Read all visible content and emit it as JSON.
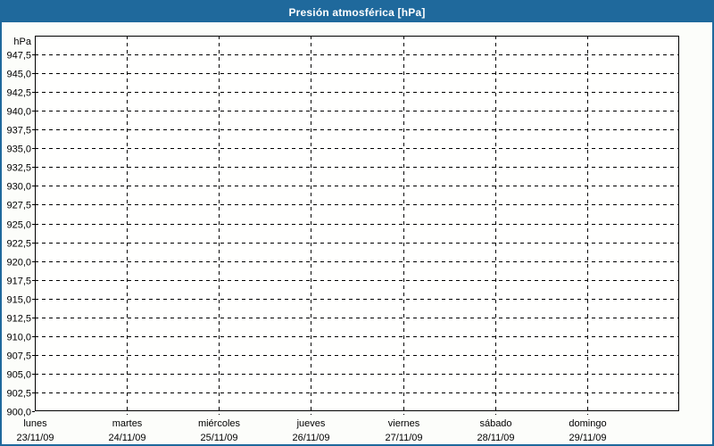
{
  "window": {
    "title": "Presión atmosférica [hPa]"
  },
  "chart_data": {
    "type": "line",
    "title": "Presión atmosférica [hPa]",
    "grid": "dashed",
    "legend": "none",
    "series": [],
    "y_axis": {
      "unit_label": "hPa",
      "min": 900,
      "max": 950,
      "tick_step": 2.5,
      "tick_labels": [
        "900,0",
        "902,5",
        "905,0",
        "907,5",
        "910,0",
        "912,5",
        "915,0",
        "917,5",
        "920,0",
        "922,5",
        "925,0",
        "927,5",
        "930,0",
        "932,5",
        "935,0",
        "937,5",
        "940,0",
        "942,5",
        "945,0",
        "947,5"
      ]
    },
    "x_axis": {
      "categories": [
        {
          "day": "lunes",
          "date": "23/11/09"
        },
        {
          "day": "martes",
          "date": "24/11/09"
        },
        {
          "day": "miércoles",
          "date": "25/11/09"
        },
        {
          "day": "jueves",
          "date": "26/11/09"
        },
        {
          "day": "viernes",
          "date": "27/11/09"
        },
        {
          "day": "sábado",
          "date": "28/11/09"
        },
        {
          "day": "domingo",
          "date": "29/11/09"
        }
      ]
    }
  },
  "colors": {
    "titlebar": "#1f699c",
    "title_text": "#ffffff",
    "frame_border": "#1f699c",
    "window_background": "#fcfdfa",
    "plot_background": "#fffffe",
    "grid": "#000000",
    "axis": "#000000",
    "text": "#000000"
  }
}
